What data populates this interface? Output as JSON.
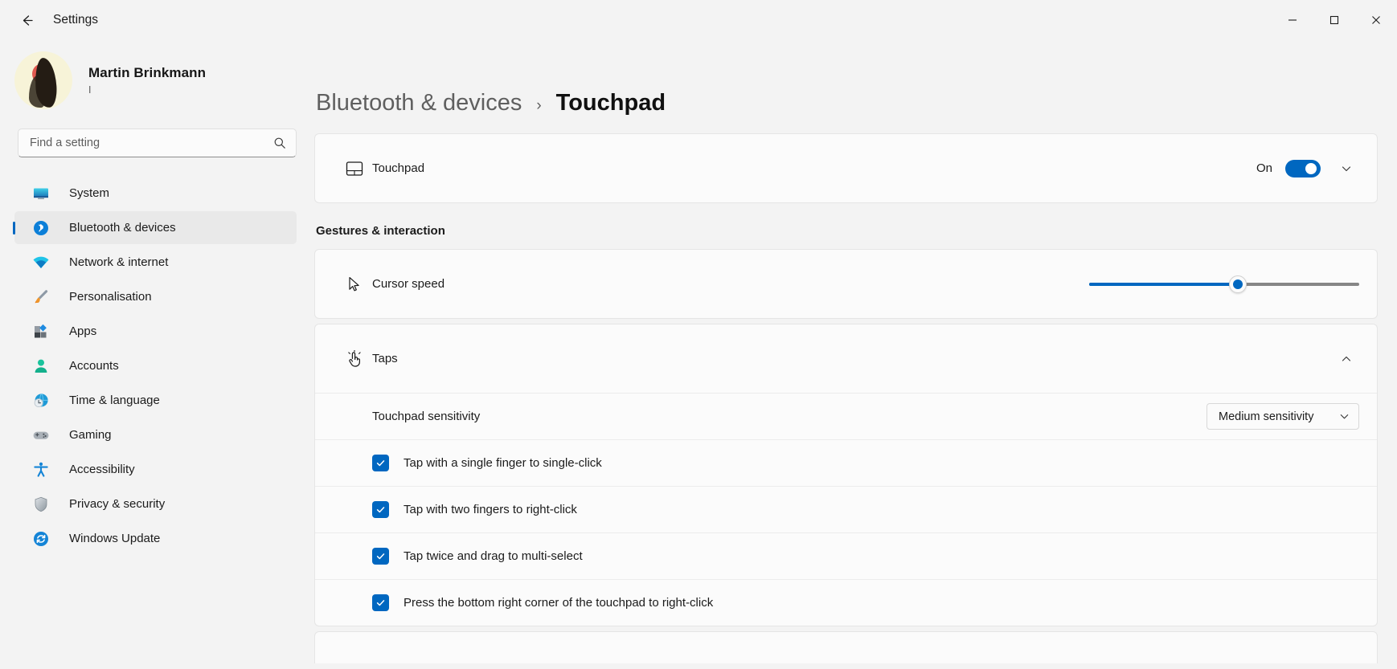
{
  "window": {
    "title": "Settings",
    "back_icon": "arrow-left-icon",
    "controls": {
      "minimize": "minimize-icon",
      "maximize": "maximize-icon",
      "close": "close-icon"
    }
  },
  "sidebar": {
    "profile": {
      "name": "Martin Brinkmann",
      "subtitle": "I",
      "avatar_icon": "user-avatar"
    },
    "search": {
      "placeholder": "Find a setting",
      "value": "",
      "icon": "search-icon"
    },
    "items": [
      {
        "label": "System",
        "icon": "system-icon",
        "active": false
      },
      {
        "label": "Bluetooth & devices",
        "icon": "bluetooth-icon",
        "active": true
      },
      {
        "label": "Network & internet",
        "icon": "network-icon",
        "active": false
      },
      {
        "label": "Personalisation",
        "icon": "brush-icon",
        "active": false
      },
      {
        "label": "Apps",
        "icon": "apps-icon",
        "active": false
      },
      {
        "label": "Accounts",
        "icon": "person-icon",
        "active": false
      },
      {
        "label": "Time & language",
        "icon": "clock-globe-icon",
        "active": false
      },
      {
        "label": "Gaming",
        "icon": "gamepad-icon",
        "active": false
      },
      {
        "label": "Accessibility",
        "icon": "accessibility-icon",
        "active": false
      },
      {
        "label": "Privacy & security",
        "icon": "shield-icon",
        "active": false
      },
      {
        "label": "Windows Update",
        "icon": "update-sync-icon",
        "active": false
      }
    ]
  },
  "breadcrumb": {
    "parent": "Bluetooth & devices",
    "separator": "›",
    "current": "Touchpad"
  },
  "main": {
    "touchpad_card": {
      "label": "Touchpad",
      "icon": "touchpad-icon",
      "state_label": "On",
      "toggle_on": true,
      "expand_icon": "chevron-down-icon"
    },
    "section_title": "Gestures & interaction",
    "cursor_speed": {
      "label": "Cursor speed",
      "icon": "cursor-pointer-icon",
      "value_percent": 55
    },
    "taps": {
      "label": "Taps",
      "icon": "tap-gesture-icon",
      "collapse_icon": "chevron-up-icon",
      "sensitivity": {
        "label": "Touchpad sensitivity",
        "selected": "Medium sensitivity",
        "chevron": "chevron-down-icon"
      },
      "checkboxes": [
        {
          "label": "Tap with a single finger to single-click",
          "checked": true
        },
        {
          "label": "Tap with two fingers to right-click",
          "checked": true
        },
        {
          "label": "Tap twice and drag to multi-select",
          "checked": true
        },
        {
          "label": "Press the bottom right corner of the touchpad to right-click",
          "checked": true
        }
      ]
    }
  },
  "colors": {
    "accent": "#0067c0",
    "window_bg": "#f3f3f3",
    "card_bg": "#fbfbfb",
    "text": "#1b1b1b",
    "muted_text": "#5f5f5f"
  }
}
